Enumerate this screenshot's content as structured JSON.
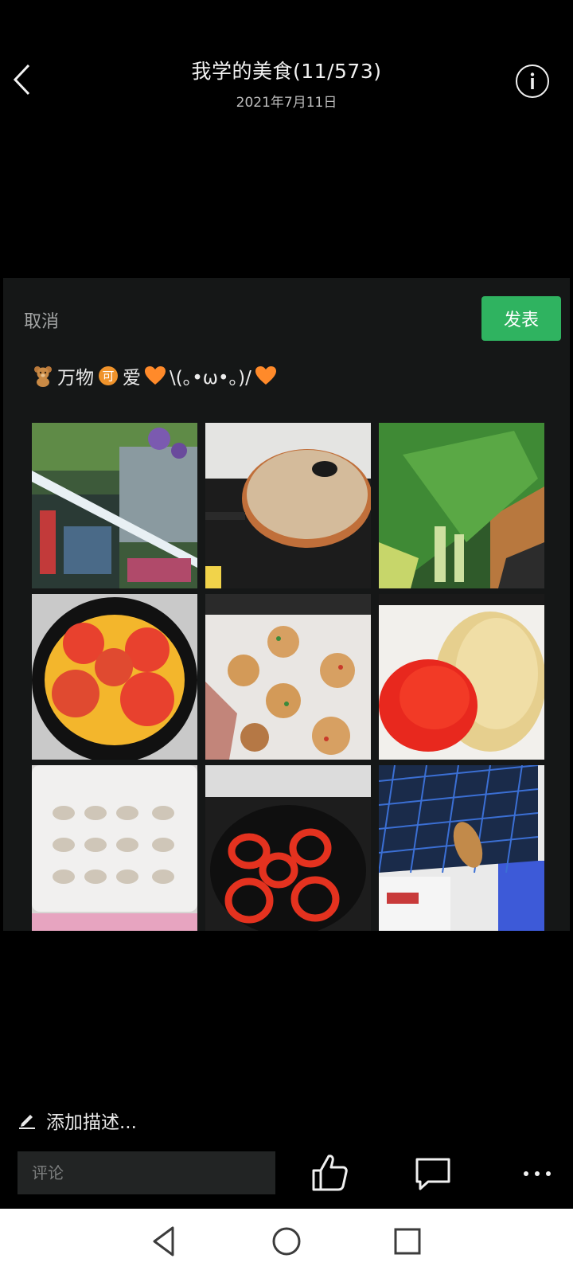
{
  "header": {
    "title": "我学的美食(11/573)",
    "date": "2021年7月11日",
    "back_icon": "chevron-left-icon",
    "info_icon": "info-icon"
  },
  "composer": {
    "cancel_label": "取消",
    "publish_label": "发表",
    "publish_color": "#2fb360",
    "caption": {
      "emoji_lead": "🧸",
      "text_1": "万物",
      "emoji_mid": "可",
      "text_2": "爱",
      "kaomoji": "\\(｡•ω•｡)/"
    },
    "photos": [
      "market-shelf-photo",
      "pan-with-lid-photo",
      "greens-photo",
      "tomato-egg-pan-photo",
      "veggie-balls-photo",
      "diced-peppers-photo",
      "shrimp-tray-photo",
      "pepper-rings-pan-photo",
      "shrimp-net-photo"
    ]
  },
  "footer": {
    "add_description": "添加描述...",
    "comment_placeholder": "评论"
  },
  "colors": {
    "background": "#000000",
    "panel": "#151717",
    "accent": "#2fb360"
  }
}
